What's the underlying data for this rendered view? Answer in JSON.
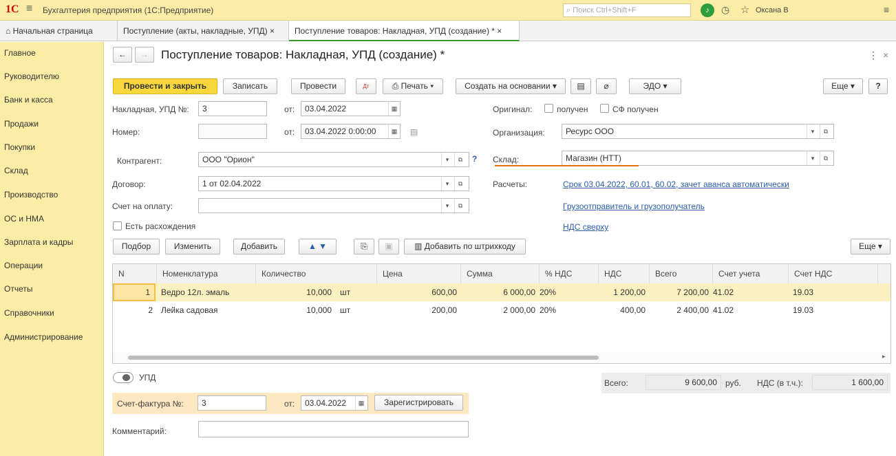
{
  "topbar": {
    "logo": "1С",
    "app_title": "Бухгалтерия предприятия (1С:Предприятие)",
    "search_placeholder": "Поиск Ctrl+Shift+F",
    "user": "Оксана В"
  },
  "tabs": [
    {
      "label": "Начальная страница"
    },
    {
      "label": "Поступление (акты, накладные, УПД) ×"
    },
    {
      "label": "Поступление товаров: Накладная, УПД (создание) * ×"
    }
  ],
  "sidebar": {
    "items": [
      "Главное",
      "Руководителю",
      "Банк и касса",
      "Продажи",
      "Покупки",
      "Склад",
      "Производство",
      "ОС и НМА",
      "Зарплата и кадры",
      "Операции",
      "Отчеты",
      "Справочники",
      "Администрирование"
    ]
  },
  "form": {
    "title": "Поступление товаров: Накладная, УПД (создание) *",
    "toolbar": {
      "post_close": "Провести и закрыть",
      "save": "Записать",
      "post": "Провести",
      "print": "Печать",
      "create_based": "Создать на основании",
      "edo": "ЭДО",
      "more": "Еще",
      "help": "?"
    },
    "fields": {
      "invoice_label": "Накладная, УПД №:",
      "invoice_no": "3",
      "date_from_label": "от:",
      "invoice_date": "03.04.2022",
      "number_label": "Номер:",
      "number_value": "",
      "number_date": "03.04.2022  0:00:00",
      "original_label": "Оригинал:",
      "received": "получен",
      "sf_received": "СФ получен",
      "org_label": "Организация:",
      "org_value": "Ресурс ООО",
      "counterparty_label": "Контрагент:",
      "counterparty_value": "ООО \"Орион\"",
      "warehouse_label": "Склад:",
      "warehouse_value": "Магазин (НТТ)",
      "contract_label": "Договор:",
      "contract_value": "1 от 02.04.2022",
      "payments_label": "Расчеты:",
      "payments_link": "Срок 03.04.2022, 60.01, 60.02, зачет аванса автоматически",
      "invoice_pay_label": "Счет на оплату:",
      "invoice_pay_value": "",
      "shipper_link": "Грузоотправитель и грузополучатель",
      "discrepancy_label": "Есть расхождения",
      "vat_link": "НДС сверху"
    },
    "table_toolbar": {
      "select": "Подбор",
      "edit": "Изменить",
      "add": "Добавить",
      "barcode": "Добавить по штрихкоду",
      "more": "Еще"
    },
    "table": {
      "columns": [
        "N",
        "Номенклатура",
        "Количество",
        "Цена",
        "Сумма",
        "% НДС",
        "НДС",
        "Всего",
        "Счет учета",
        "Счет НДС"
      ],
      "rows": [
        {
          "n": "1",
          "item": "Ведро 12л. эмаль",
          "qty": "10,000",
          "unit": "шт",
          "price": "600,00",
          "sum": "6 000,00",
          "vat_rate": "20%",
          "vat": "1 200,00",
          "total": "7 200,00",
          "account": "41.02",
          "vat_account": "19.03"
        },
        {
          "n": "2",
          "item": "Лейка садовая",
          "qty": "10,000",
          "unit": "шт",
          "price": "200,00",
          "sum": "2 000,00",
          "vat_rate": "20%",
          "vat": "400,00",
          "total": "2 400,00",
          "account": "41.02",
          "vat_account": "19.03"
        }
      ]
    },
    "footer": {
      "upd_label": "УПД",
      "total_label": "Всего:",
      "total_value": "9 600,00",
      "currency": "руб.",
      "vat_incl_label": "НДС (в т.ч.):",
      "vat_incl_value": "1 600,00",
      "sf_label": "Счет-фактура №:",
      "sf_no": "3",
      "sf_date_label": "от:",
      "sf_date": "03.04.2022",
      "register": "Зарегистрировать",
      "comment_label": "Комментарий:",
      "comment_value": ""
    }
  }
}
